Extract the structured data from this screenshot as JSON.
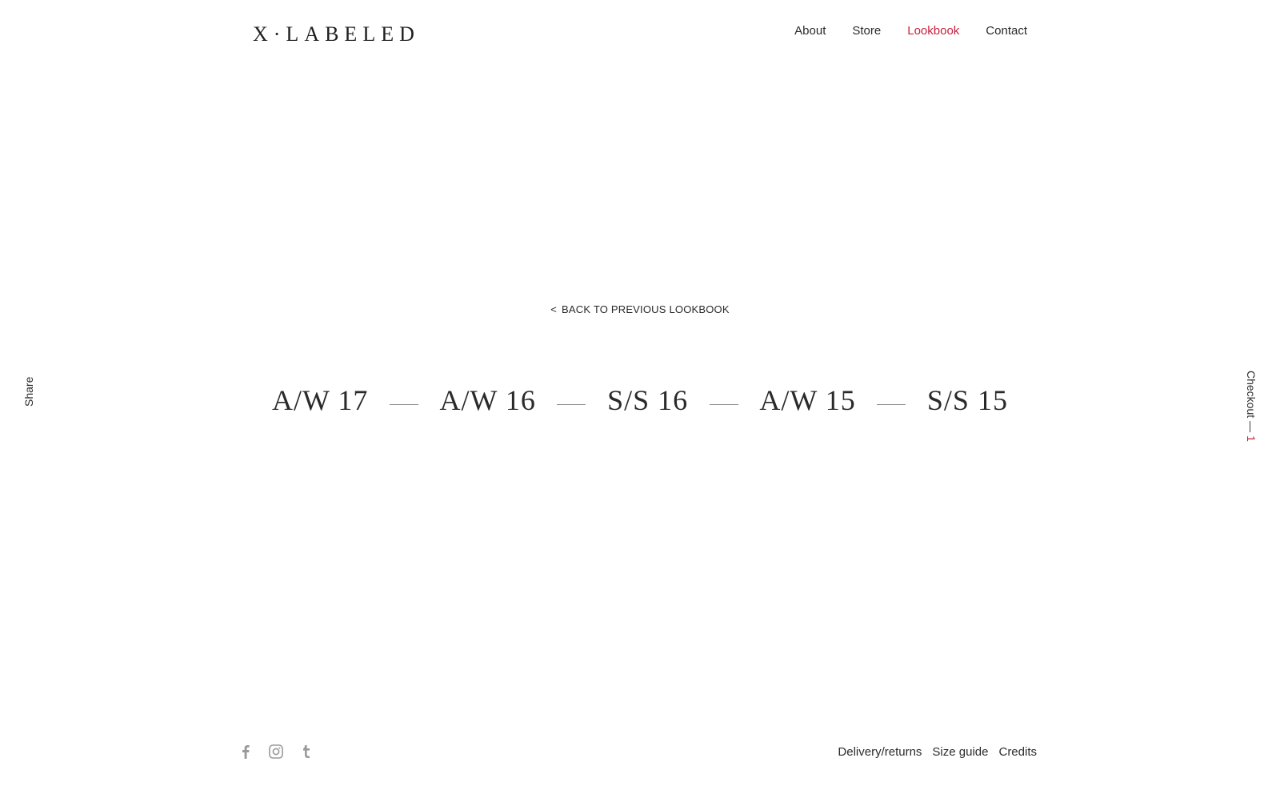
{
  "brand": {
    "logo": "X·LABELED"
  },
  "nav": {
    "items": [
      {
        "label": "About"
      },
      {
        "label": "Store"
      },
      {
        "label": "Lookbook"
      },
      {
        "label": "Contact"
      }
    ]
  },
  "back_link": {
    "label": "BACK TO PREVIOUS LOOKBOOK",
    "chevron": "<"
  },
  "seasons": [
    {
      "label": "A/W 17"
    },
    {
      "label": "A/W 16"
    },
    {
      "label": "S/S 16"
    },
    {
      "label": "A/W 15"
    },
    {
      "label": "S/S 15"
    }
  ],
  "share": {
    "label": "Share"
  },
  "checkout": {
    "label": "Checkout",
    "count": "1"
  },
  "footer": {
    "social_icons": [
      "facebook-icon",
      "instagram-icon",
      "tumblr-icon"
    ],
    "links": [
      {
        "label": "Delivery/returns"
      },
      {
        "label": "Size guide"
      },
      {
        "label": "Credits"
      }
    ]
  },
  "colors": {
    "accent": "#c8203c",
    "text": "#2a2a2a",
    "icon": "#9a9a9a"
  }
}
